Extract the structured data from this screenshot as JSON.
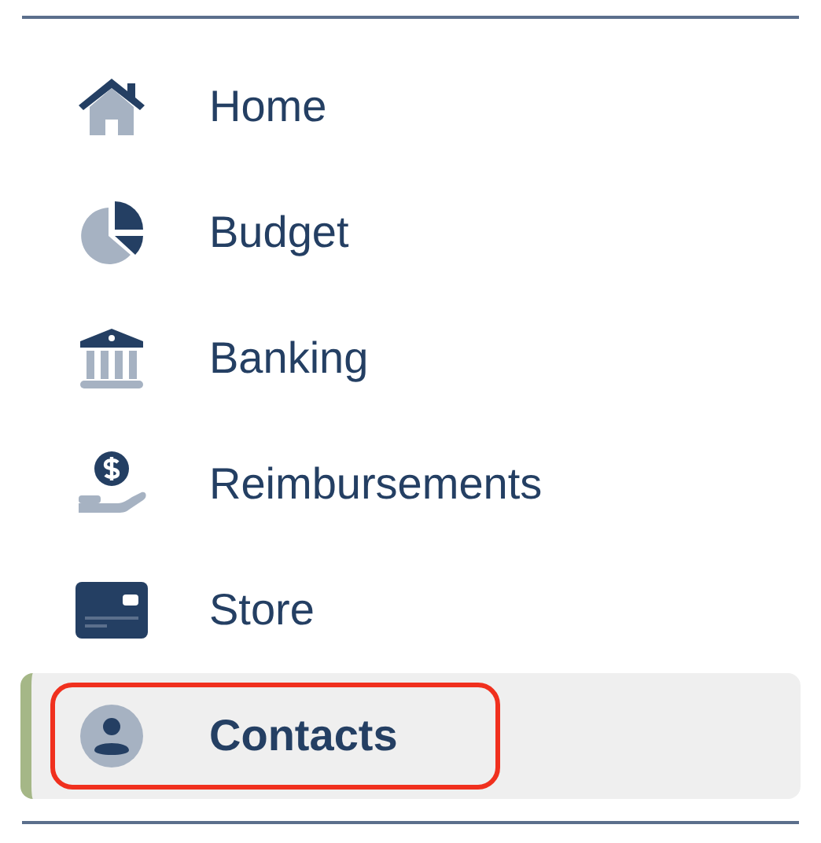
{
  "nav": {
    "items": [
      {
        "label": "Home",
        "selected": false,
        "highlighted": false
      },
      {
        "label": "Budget",
        "selected": false,
        "highlighted": false
      },
      {
        "label": "Banking",
        "selected": false,
        "highlighted": false
      },
      {
        "label": "Reimbursements",
        "selected": false,
        "highlighted": false
      },
      {
        "label": "Store",
        "selected": false,
        "highlighted": false
      },
      {
        "label": "Contacts",
        "selected": true,
        "highlighted": true
      }
    ]
  }
}
